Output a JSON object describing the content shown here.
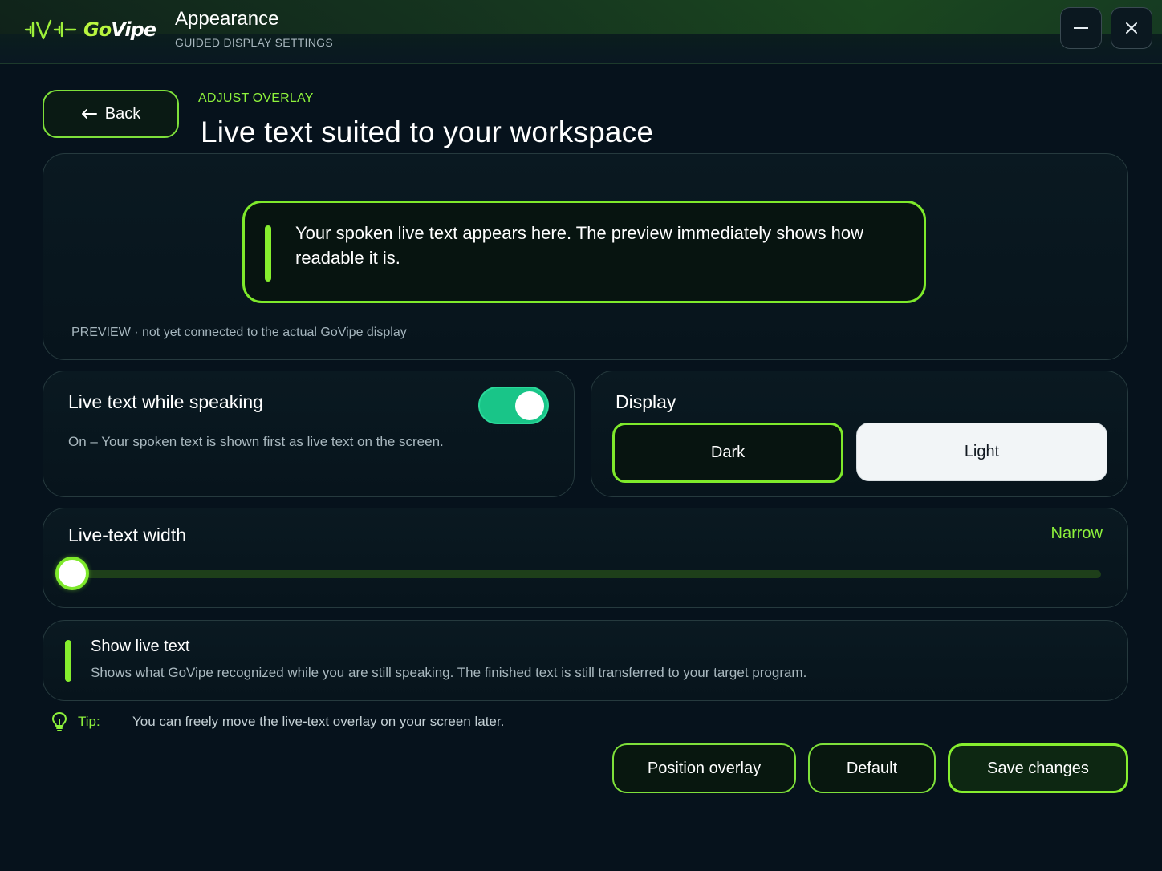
{
  "app": {
    "logo_prefix": "Go",
    "logo_suffix": "Vipe",
    "title": "Appearance",
    "subtitle": "GUIDED DISPLAY SETTINGS",
    "minimize_icon": "minimize-icon",
    "close_icon": "close-icon"
  },
  "header": {
    "back_label": "Back",
    "back_icon": "arrow-left-icon",
    "kicker": "ADJUST OVERLAY",
    "title": "Live text suited to your workspace"
  },
  "preview": {
    "text": "Your spoken live text appears here. The preview immediately shows how readable it is.",
    "note": "PREVIEW · not yet connected to the actual GoVipe display"
  },
  "live_text_toggle": {
    "title": "Live text while speaking",
    "description": "On – Your spoken text is shown first as live text on the screen.",
    "enabled": true
  },
  "display": {
    "title": "Display",
    "options": [
      "Dark",
      "Light"
    ],
    "selected": "Dark"
  },
  "width": {
    "title": "Live-text width",
    "value_label": "Narrow",
    "level": 0
  },
  "info": {
    "title": "Show live text",
    "description": "Shows what GoVipe recognized while you are still speaking. The finished text is still transferred to your target program."
  },
  "tip": {
    "icon": "lightbulb-icon",
    "label": "Tip:",
    "text": "You can freely move the live-text overlay on your screen later."
  },
  "actions": {
    "position_label": "Position overlay",
    "default_label": "Default",
    "save_label": "Save changes"
  },
  "colors": {
    "accent": "#7ee92b",
    "toggle_on": "#19c588",
    "background": "#06121c"
  }
}
